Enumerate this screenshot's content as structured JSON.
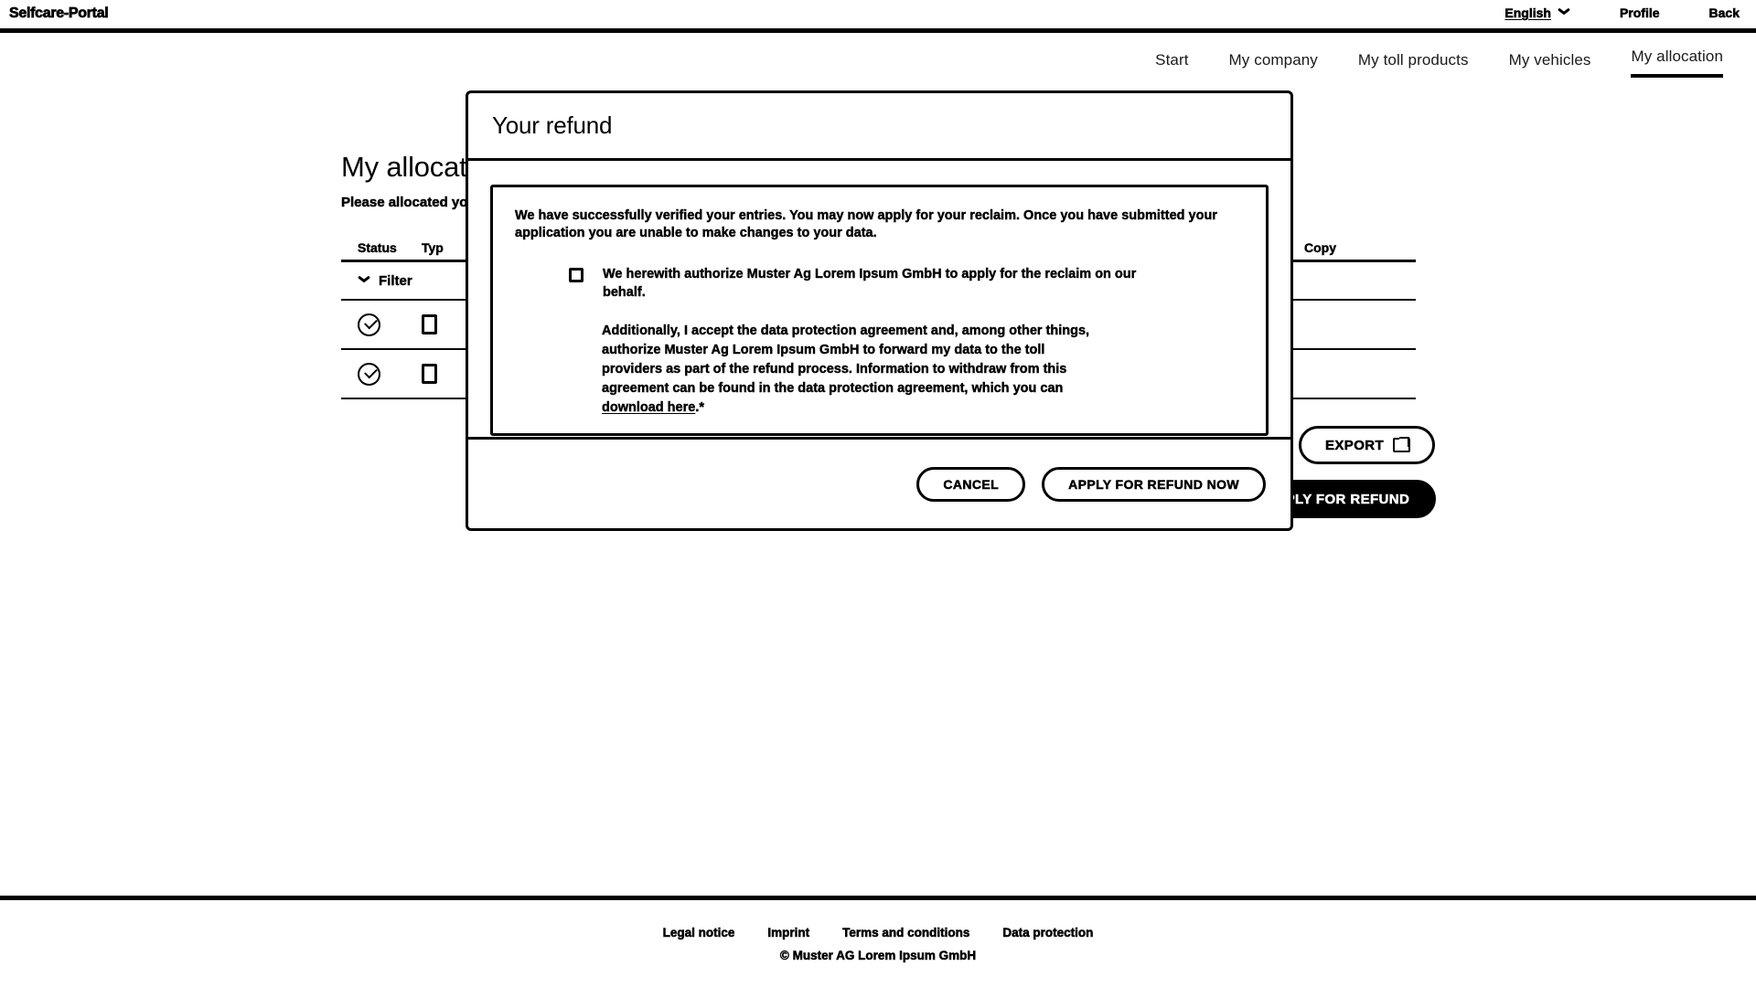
{
  "topbar": {
    "logo": "Selfcare-Portal",
    "language": {
      "label": "English",
      "icon": "chevron-down-icon"
    },
    "profile_label": "Profile",
    "back_label": "Back"
  },
  "nav": {
    "items": [
      {
        "label": "Start",
        "active": false
      },
      {
        "label": "My company",
        "active": false
      },
      {
        "label": "My toll products",
        "active": false
      },
      {
        "label": "My vehicles",
        "active": false
      },
      {
        "label": "My allocation",
        "active": true
      }
    ]
  },
  "page": {
    "title": "My allocation",
    "subtitle": "Please allocated yo"
  },
  "table": {
    "columns": [
      {
        "key": "status",
        "label": "Status"
      },
      {
        "key": "type",
        "label": "Typ"
      },
      {
        "key": "copy",
        "label": "Copy"
      }
    ],
    "filter_label": "Filter",
    "filter_icon": "chevron-down-icon",
    "rows": [
      {
        "status_icon": "check-circle-icon",
        "type_icon": "document-icon"
      },
      {
        "status_icon": "check-circle-icon",
        "type_icon": "document-icon"
      }
    ]
  },
  "actions": {
    "export_label": "EXPORT",
    "export_icon": "external-link-icon",
    "apply_refund_label": "APPLY FOR REFUND"
  },
  "modal": {
    "title": "Your refund",
    "intro_text": "We have successfully verified your entries. You may now apply for your reclaim. Once you have submitted your application you are unable to make changes to your data.",
    "checkbox_label": "We herewith authorize Muster Ag Lorem Ipsum GmbH to apply for the reclaim on our behalf.",
    "checkbox_checked": false,
    "privacy_text_before_link": "Additionally, I accept the data protection agreement and, among other things, authorize Muster Ag Lorem Ipsum GmbH to forward my data to the toll providers as part of the refund process. Information to withdraw from this agreement can be found in the data protection agreement, which you can ",
    "privacy_link_label": "download here",
    "privacy_text_after_link": ".*",
    "cancel_label": "CANCEL",
    "submit_label": "APPLY FOR REFUND NOW"
  },
  "footer": {
    "links": [
      {
        "label": "Legal notice"
      },
      {
        "label": "Imprint"
      },
      {
        "label": "Terms and conditions"
      },
      {
        "label": "Data protection"
      }
    ],
    "copyright": "© Muster AG Lorem Ipsum GmbH"
  },
  "colors": {
    "background": "#ffffff",
    "foreground": "#000000",
    "accent": "#000000"
  }
}
